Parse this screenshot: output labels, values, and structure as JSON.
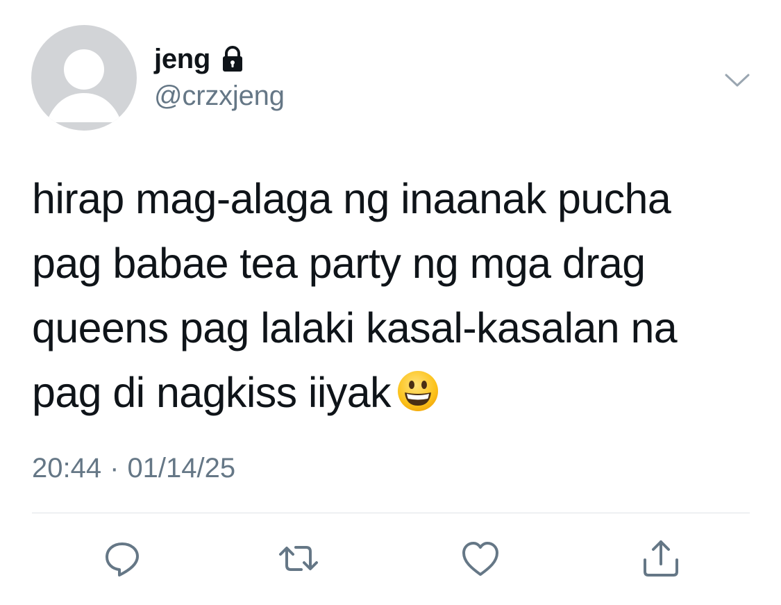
{
  "tweet": {
    "display_name": "jeng",
    "handle": "@crzxjeng",
    "protected_icon": "lock-icon",
    "text": "hirap mag-alaga ng inaanak pucha\npag babae tea party ng mga drag\nqueens pag lalaki kasal-kasalan na\npag di nagkiss iiyak",
    "emoji": "grinning-face-emoji",
    "time": "20:44",
    "date": "01/14/25",
    "separator": "·"
  },
  "actions": {
    "reply_icon": "reply-icon",
    "retweet_icon": "retweet-icon",
    "like_icon": "heart-icon",
    "share_icon": "share-icon"
  },
  "colors": {
    "text": "#0f1419",
    "secondary": "#657786",
    "avatar_bg": "#d2d4d7",
    "divider": "#dfe3e7"
  }
}
